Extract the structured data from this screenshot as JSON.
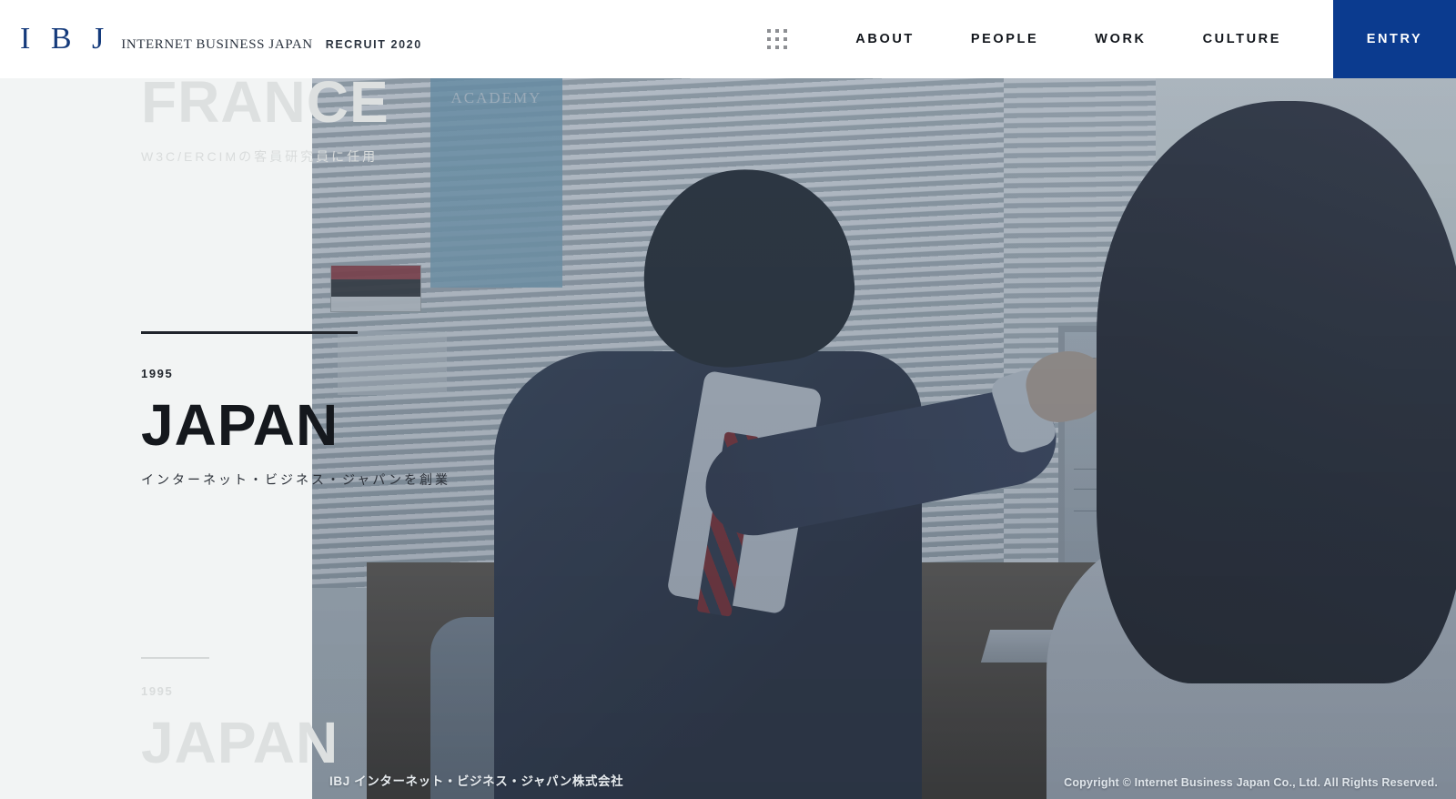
{
  "header": {
    "logo_mark": "I B J",
    "logo_name": "INTERNET BUSINESS JAPAN",
    "logo_recruit": "RECRUIT 2020",
    "grid_icon": "grid-dots-icon",
    "nav": [
      {
        "label": "ABOUT"
      },
      {
        "label": "PEOPLE"
      },
      {
        "label": "WORK"
      },
      {
        "label": "CULTURE"
      }
    ],
    "entry_label": "ENTRY",
    "entry_color": "#0b3b8f"
  },
  "timeline": {
    "previous": {
      "title": "FRANCE",
      "subtitle": "W3C/ERCIMの客員研究員に任用"
    },
    "active": {
      "year": "1995",
      "title": "JAPAN",
      "subtitle": "インターネット・ビジネス・ジャパンを創業"
    },
    "next": {
      "year": "1995",
      "title": "JAPAN"
    }
  },
  "photo": {
    "academy_sign": "ACADEMY",
    "alt": "office-scene-man-pointing-at-monitor"
  },
  "footer": {
    "company": "IBJ インターネット・ビジネス・ジャパン株式会社",
    "copyright": "Copyright © Internet Business Japan Co., Ltd. All Rights Reserved."
  }
}
